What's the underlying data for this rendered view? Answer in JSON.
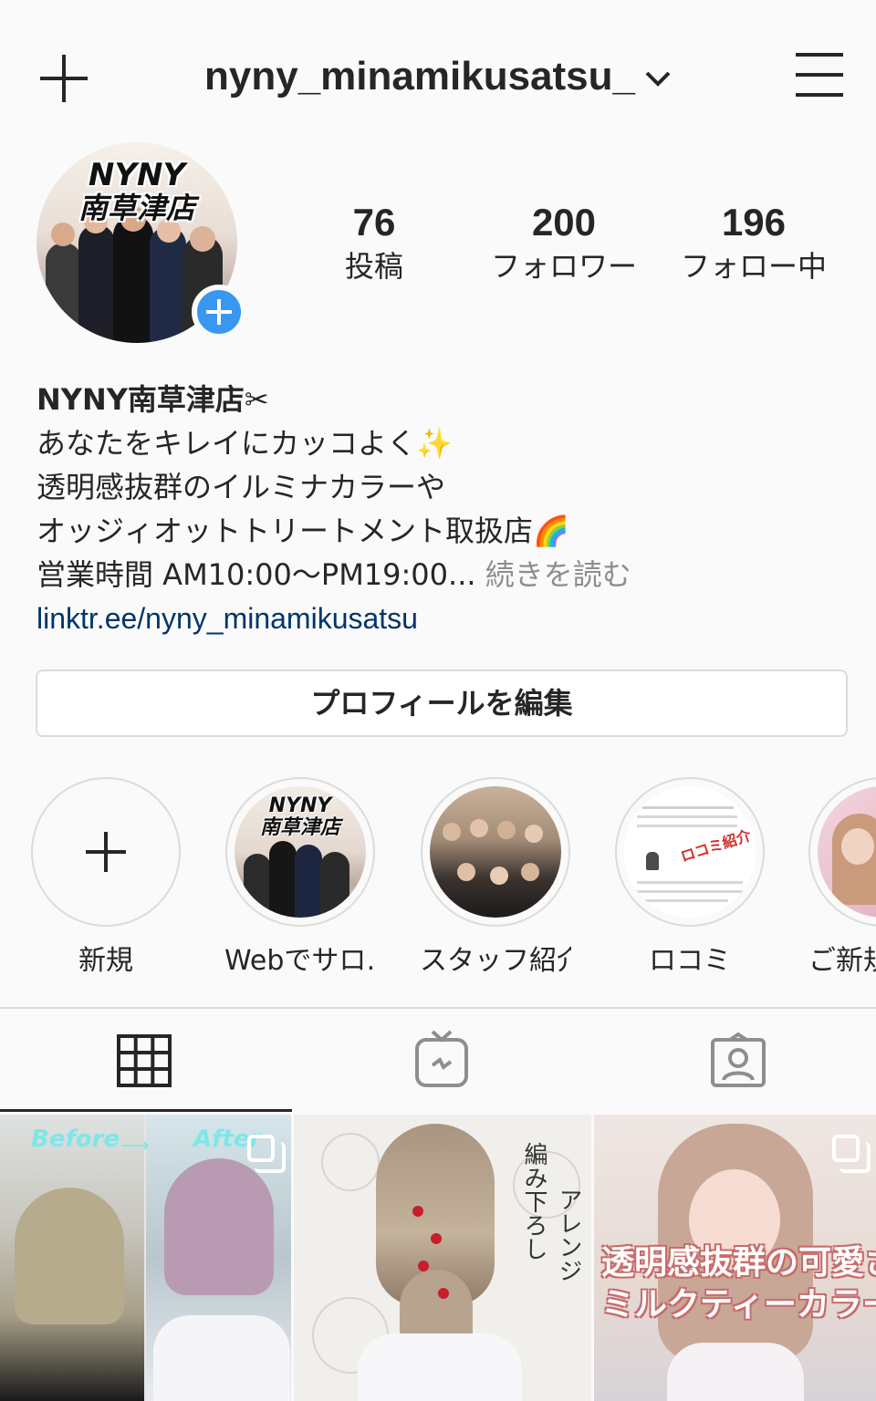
{
  "header": {
    "username": "nyny_minamikusatsu_"
  },
  "avatar": {
    "stamp_line1": "NYNY",
    "stamp_line2": "南草津店"
  },
  "stats": [
    {
      "number": "76",
      "label": "投稿"
    },
    {
      "number": "200",
      "label": "フォロワー"
    },
    {
      "number": "196",
      "label": "フォロー中"
    }
  ],
  "bio": {
    "name": "NYNY南草津店✂",
    "line1": "あなたをキレイにカッコよく✨",
    "line2": "透明感抜群のイルミナカラーや",
    "line3": "オッジィオットトリートメント取扱店🌈",
    "line4": "営業時間 AM10:00〜PM19:00...",
    "more": "続きを読む",
    "link": "linktr.ee/nyny_minamikusatsu"
  },
  "edit_profile": "プロフィールを編集",
  "highlights": [
    {
      "label": "新規"
    },
    {
      "label": "Webでサロ…",
      "stamp_line1": "NYNY",
      "stamp_line2": "南草津店"
    },
    {
      "label": "スタッフ紹介"
    },
    {
      "label": "ロコミ",
      "badge": "ロコミ紹介"
    },
    {
      "label": "ご新規"
    }
  ],
  "posts": [
    {
      "before_label": "Before",
      "after_label": "After"
    },
    {
      "handwriting_1": "編み下ろし",
      "handwriting_2": "アレンジ"
    },
    {
      "caption_line1": "透明感抜群の可愛さ",
      "caption_line2": "ミルクティーカラー"
    }
  ],
  "colors": {
    "accent_blue": "#3897f0",
    "link": "#003569",
    "muted": "#8e8e8e",
    "border": "#dbdbdb"
  }
}
